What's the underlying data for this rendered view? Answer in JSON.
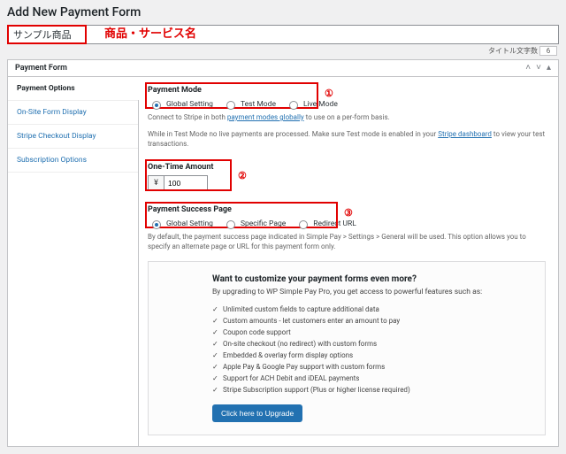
{
  "page": {
    "heading": "Add New Payment Form"
  },
  "title": {
    "value": "サンプル商品",
    "annotation": "商品・サービス名",
    "counter_label": "タイトル文字数",
    "counter_value": "6"
  },
  "postbox": {
    "title": "Payment Form"
  },
  "tabs": {
    "items": [
      {
        "label": "Payment Options"
      },
      {
        "label": "On-Site Form Display"
      },
      {
        "label": "Stripe Checkout Display"
      },
      {
        "label": "Subscription Options"
      }
    ]
  },
  "payment_mode": {
    "label": "Payment Mode",
    "options": {
      "global": "Global Setting",
      "test": "Test Mode",
      "live": "Live Mode"
    },
    "numeral": "①",
    "helper_pre": "Connect to Stripe in both ",
    "helper_link": "payment modes globally",
    "helper_post": " to use on a per-form basis.",
    "helper2_pre": "While in Test Mode no live payments are processed. Make sure Test mode is enabled in your ",
    "helper2_link": "Stripe dashboard",
    "helper2_post": " to view your test transactions."
  },
  "one_time_amount": {
    "label": "One-Time Amount",
    "prefix": "¥",
    "value": "100",
    "numeral": "②"
  },
  "success_page": {
    "label": "Payment Success Page",
    "options": {
      "global": "Global Setting",
      "specific": "Specific Page",
      "redirect": "Redirect URL"
    },
    "numeral": "③",
    "helper": "By default, the payment success page indicated in Simple Pay > Settings > General will be used. This option allows you to specify an alternate page or URL for this payment form only."
  },
  "upsell": {
    "title": "Want to customize your payment forms even more?",
    "subtitle": "By upgrading to WP Simple Pay Pro, you get access to powerful features such as:",
    "features": [
      "Unlimited custom fields to capture additional data",
      "Custom amounts - let customers enter an amount to pay",
      "Coupon code support",
      "On-site checkout (no redirect) with custom forms",
      "Embedded & overlay form display options",
      "Apple Pay & Google Pay support with custom forms",
      "Support for ACH Debit and iDEAL payments",
      "Stripe Subscription support (Plus or higher license required)"
    ],
    "button": "Click here to Upgrade"
  }
}
